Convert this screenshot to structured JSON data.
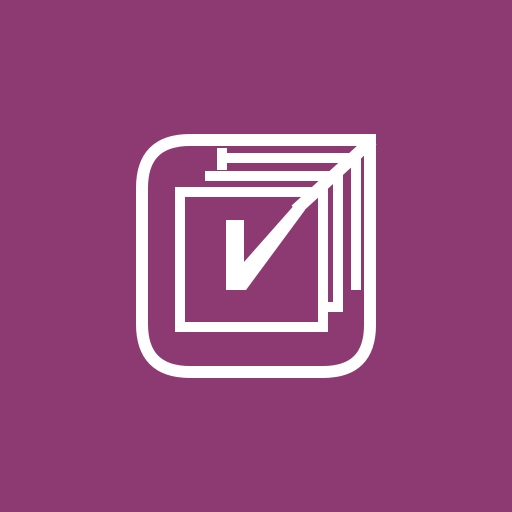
{
  "app": {
    "icon": "stacked-checkbox-logo",
    "colors": {
      "background": "#8d3a72",
      "foreground": "#ffffff"
    }
  }
}
